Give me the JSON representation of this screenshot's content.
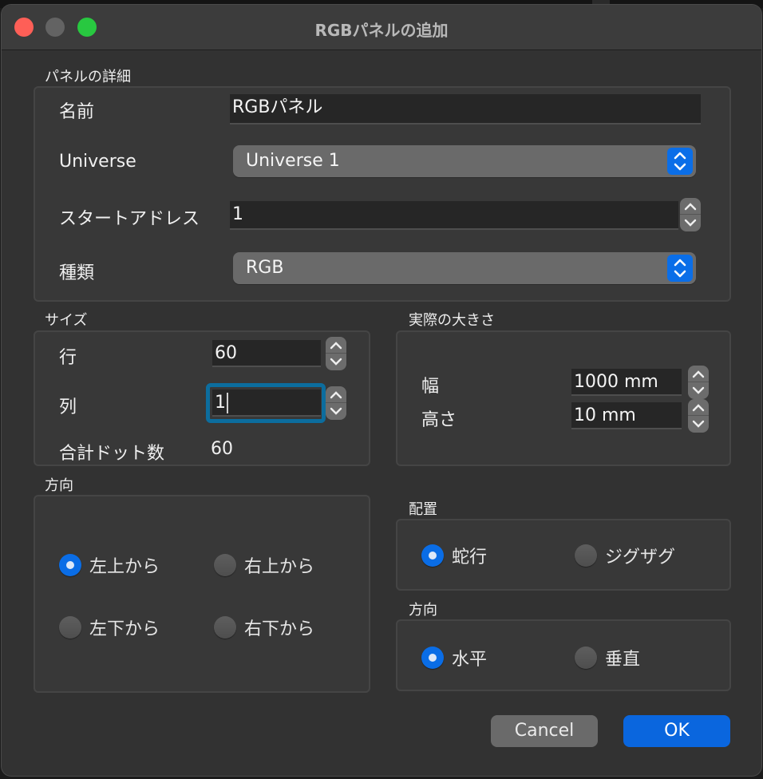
{
  "window": {
    "title": "RGBパネルの追加"
  },
  "panel_details": {
    "group_label": "パネルの詳細",
    "name_label": "名前",
    "name_value": "RGBパネル",
    "universe_label": "Universe",
    "universe_value": "Universe 1",
    "start_address_label": "スタートアドレス",
    "start_address_value": "1",
    "type_label": "種類",
    "type_value": "RGB"
  },
  "size": {
    "group_label": "サイズ",
    "rows_label": "行",
    "rows_value": "60",
    "columns_label": "列",
    "columns_value": "1",
    "total_label": "合計ドット数",
    "total_value": "60"
  },
  "physical": {
    "group_label": "実際の大きさ",
    "width_label": "幅",
    "width_value": "1000 mm",
    "height_label": "高さ",
    "height_value": "10 mm"
  },
  "start_direction": {
    "group_label": "方向",
    "options": [
      {
        "label": "左上から",
        "checked": true
      },
      {
        "label": "右上から",
        "checked": false
      },
      {
        "label": "左下から",
        "checked": false
      },
      {
        "label": "右下から",
        "checked": false
      }
    ]
  },
  "placement": {
    "group_label": "配置",
    "options": [
      {
        "label": "蛇行",
        "checked": true
      },
      {
        "label": "ジグザグ",
        "checked": false
      }
    ]
  },
  "orientation": {
    "group_label": "方向",
    "options": [
      {
        "label": "水平",
        "checked": true
      },
      {
        "label": "垂直",
        "checked": false
      }
    ]
  },
  "buttons": {
    "cancel": "Cancel",
    "ok": "OK"
  },
  "colors": {
    "accent": "#0a6de6",
    "focus_ring": "#0c6d9e",
    "close": "#fe5f57",
    "zoom": "#28c840"
  }
}
